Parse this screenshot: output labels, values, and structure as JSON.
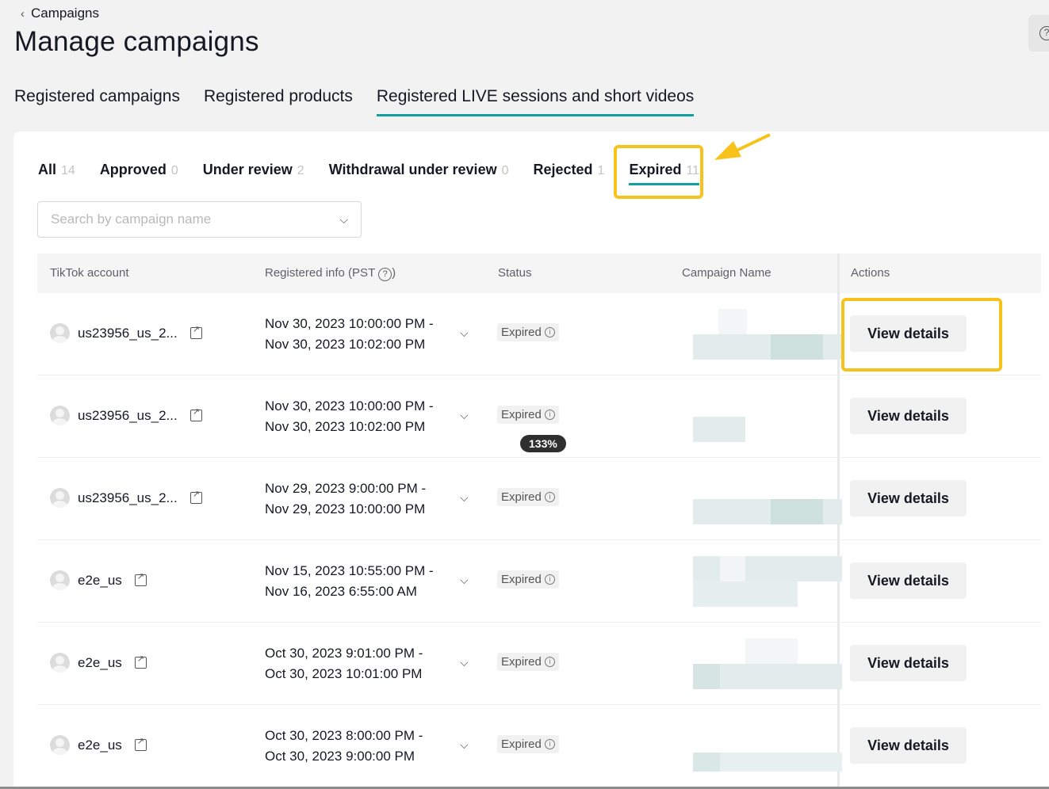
{
  "breadcrumb": {
    "back_label": "Campaigns"
  },
  "page_title": "Manage campaigns",
  "main_tabs": [
    {
      "label": "Registered campaigns"
    },
    {
      "label": "Registered products"
    },
    {
      "label": "Registered LIVE sessions and short videos"
    }
  ],
  "sub_tabs": [
    {
      "label": "All",
      "count": "14"
    },
    {
      "label": "Approved",
      "count": "0"
    },
    {
      "label": "Under review",
      "count": "2"
    },
    {
      "label": "Withdrawal under review",
      "count": "0"
    },
    {
      "label": "Rejected",
      "count": "1"
    },
    {
      "label": "Expired",
      "count": "11"
    }
  ],
  "search": {
    "placeholder": "Search by campaign name"
  },
  "table": {
    "columns": {
      "account": "TikTok account",
      "registered": "Registered info (PST",
      "status": "Status",
      "campaign": "Campaign Name",
      "actions": "Actions"
    },
    "rows": [
      {
        "account": "us23956_us_2...",
        "start": "Nov 30, 2023 10:00:00 PM -",
        "end": "Nov 30, 2023 10:02:00 PM",
        "status": "Expired",
        "action": "View details"
      },
      {
        "account": "us23956_us_2...",
        "start": "Nov 30, 2023 10:00:00 PM -",
        "end": "Nov 30, 2023 10:02:00 PM",
        "status": "Expired",
        "action": "View details"
      },
      {
        "account": "us23956_us_2...",
        "start": "Nov 29, 2023 9:00:00 PM -",
        "end": "Nov 29, 2023 10:00:00 PM",
        "status": "Expired",
        "action": "View details"
      },
      {
        "account": "e2e_us",
        "start": "Nov 15, 2023 10:55:00 PM -",
        "end": "Nov 16, 2023 6:55:00 AM",
        "status": "Expired",
        "action": "View details"
      },
      {
        "account": "e2e_us",
        "start": "Oct 30, 2023 9:01:00 PM -",
        "end": "Oct 30, 2023 10:01:00 PM",
        "status": "Expired",
        "action": "View details"
      },
      {
        "account": "e2e_us",
        "start": "Oct 30, 2023 8:00:00 PM -",
        "end": "Oct 30, 2023 9:00:00 PM",
        "status": "Expired",
        "action": "View details"
      }
    ]
  },
  "zoom_badge": "133%",
  "colors": {
    "accent": "#0fa0a0",
    "highlight": "#f7c31b"
  }
}
